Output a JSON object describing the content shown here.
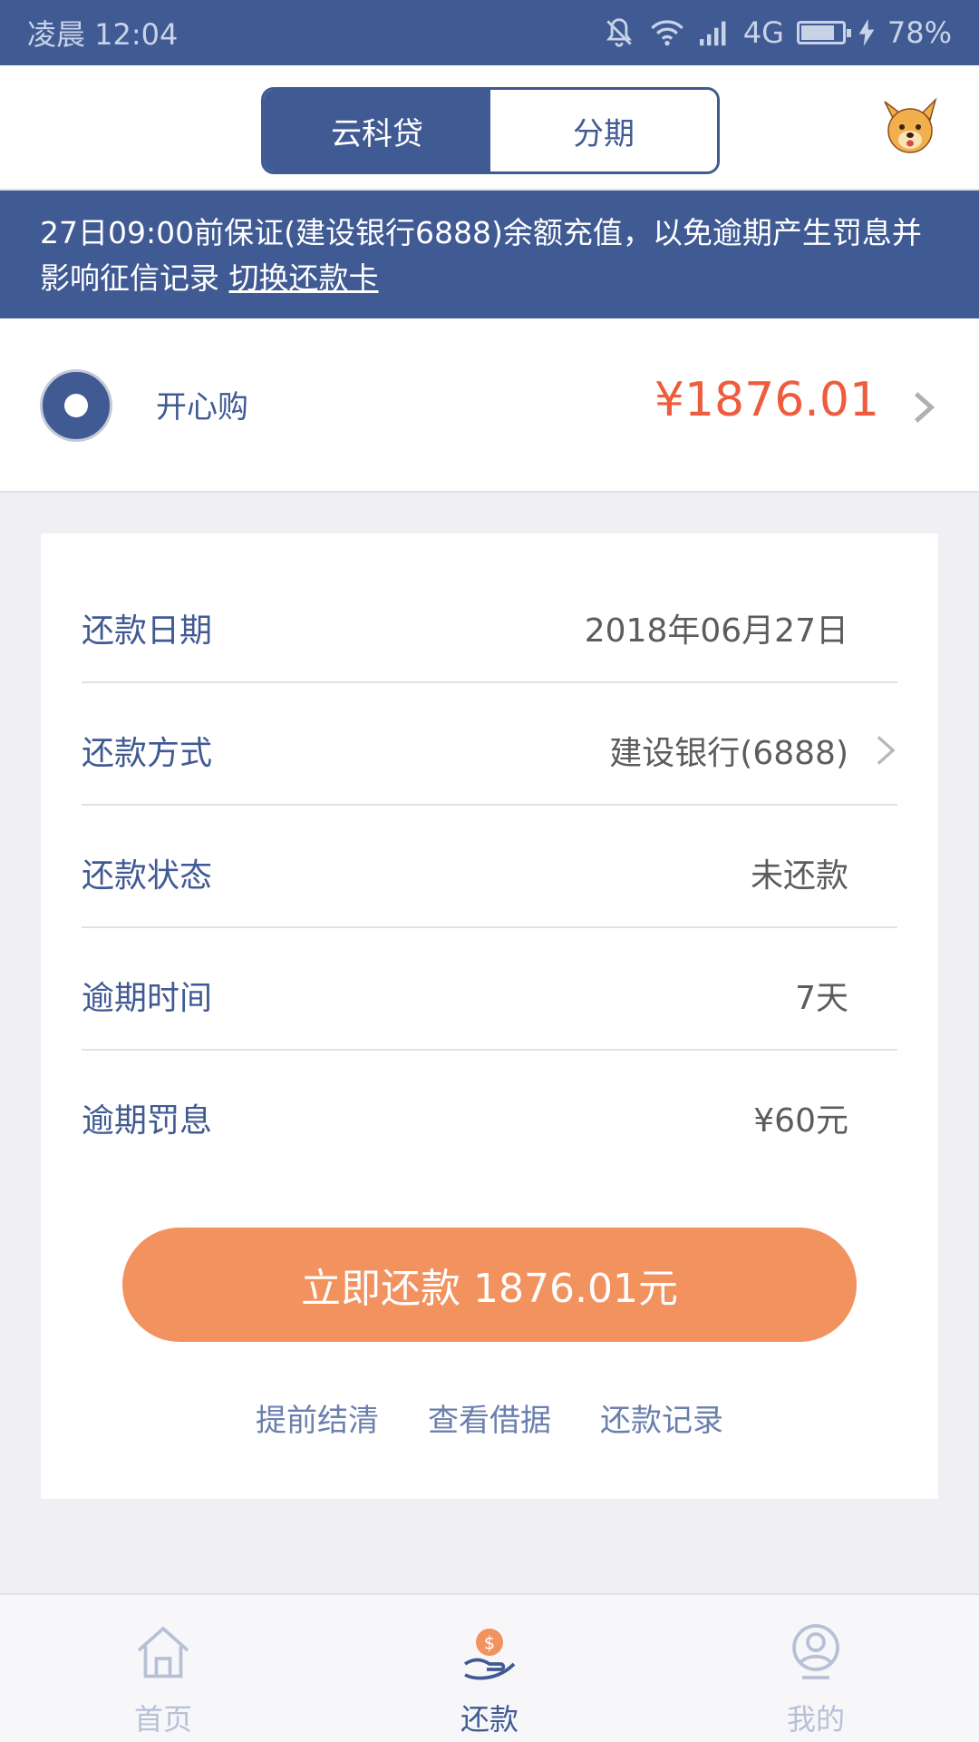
{
  "status_bar": {
    "time": "凌晨 12:04",
    "network": "4G",
    "battery": "78%"
  },
  "header": {
    "tabs": [
      {
        "label": "云科贷",
        "active": true
      },
      {
        "label": "分期",
        "active": false
      }
    ]
  },
  "notice": {
    "text": "27日09:00前保证(建设银行6888)余额充值，以免逾期产生罚息并影响征信记录 ",
    "link": "切换还款卡"
  },
  "loan": {
    "name": "开心购",
    "amount": "¥1876.01"
  },
  "details": [
    {
      "label": "还款日期",
      "value": "2018年06月27日"
    },
    {
      "label": "还款方式",
      "value": "建设银行(6888)"
    },
    {
      "label": "还款状态",
      "value": "未还款"
    },
    {
      "label": "逾期时间",
      "value": "7天"
    },
    {
      "label": "逾期罚息",
      "value": "¥60元"
    }
  ],
  "pay_button": "立即还款 1876.01元",
  "links": {
    "settle": "提前结清",
    "receipt": "查看借据",
    "history": "还款记录"
  },
  "nav": {
    "home": "首页",
    "repay": "还款",
    "mine": "我的"
  },
  "colors": {
    "primary": "#405a93",
    "accent": "#f2925f",
    "amount": "#ef5b3d"
  }
}
